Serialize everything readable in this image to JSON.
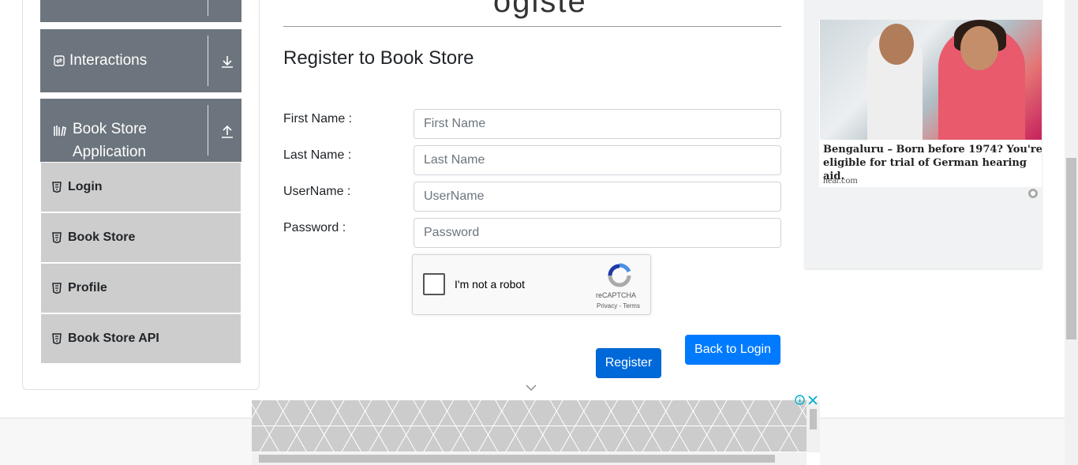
{
  "sidebar": {
    "groups": [
      {
        "label": "Interactions"
      },
      {
        "label": "Book Store Application"
      }
    ],
    "items": [
      {
        "label": "Login"
      },
      {
        "label": "Book Store"
      },
      {
        "label": "Profile"
      },
      {
        "label": "Book Store API"
      }
    ]
  },
  "main": {
    "header_remnant": "ogiste",
    "form_title": "Register to Book Store",
    "fields": [
      {
        "label": "First Name :",
        "placeholder": "First Name"
      },
      {
        "label": "Last Name :",
        "placeholder": "Last Name"
      },
      {
        "label": "UserName :",
        "placeholder": "UserName"
      },
      {
        "label": "Password :",
        "placeholder": "Password"
      }
    ],
    "captcha": {
      "text": "I'm not a robot",
      "brand": "reCAPTCHA",
      "terms": "Privacy - Terms"
    },
    "register_label": "Register",
    "back_label": "Back to Login"
  },
  "ad": {
    "headline": "Bengaluru – Born before 1974? You're eligible for trial of German hearing aid.",
    "domain": "hear.com"
  },
  "colors": {
    "primary": "#007bff",
    "sidebar_header": "#6c757d",
    "menu_item": "#cdcdcd"
  }
}
